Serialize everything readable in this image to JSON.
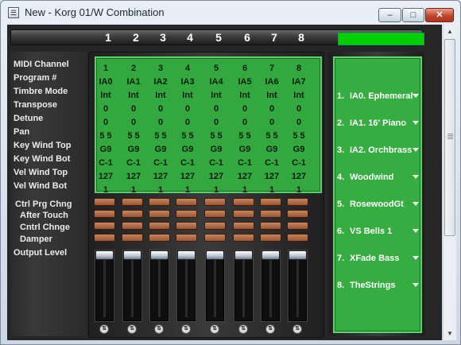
{
  "window": {
    "title": "New - Korg 01/W Combination",
    "app_icon_glyph": "☰",
    "minimize_glyph": "–",
    "maximize_glyph": "□",
    "close_glyph": "✕"
  },
  "channels": [
    "1",
    "2",
    "3",
    "4",
    "5",
    "6",
    "7",
    "8"
  ],
  "level_meter": {
    "color": "#00d000"
  },
  "param_labels": [
    "MIDI Channel",
    "Program #",
    "Timbre Mode",
    "Transpose",
    "Detune",
    "Pan",
    "Key Wind Top",
    "Key Wind Bot",
    "Vel Wind Top",
    "Vel Wind Bot"
  ],
  "toggle_labels": [
    "Ctrl Prg Chng",
    "After Touch",
    "Cntrl Chnge",
    "Damper"
  ],
  "output_label": "Output Level",
  "grid": [
    [
      "1",
      "2",
      "3",
      "4",
      "5",
      "6",
      "7",
      "8"
    ],
    [
      "IA0",
      "IA1",
      "IA2",
      "IA3",
      "IA4",
      "IA5",
      "IA6",
      "IA7"
    ],
    [
      "Int",
      "Int",
      "Int",
      "Int",
      "Int",
      "Int",
      "Int",
      "Int"
    ],
    [
      "0",
      "0",
      "0",
      "0",
      "0",
      "0",
      "0",
      "0"
    ],
    [
      "0",
      "0",
      "0",
      "0",
      "0",
      "0",
      "0",
      "0"
    ],
    [
      "5 5",
      "5 5",
      "5 5",
      "5 5",
      "5 5",
      "5 5",
      "5 5",
      "5 5"
    ],
    [
      "G9",
      "G9",
      "G9",
      "G9",
      "G9",
      "G9",
      "G9",
      "G9"
    ],
    [
      "C-1",
      "C-1",
      "C-1",
      "C-1",
      "C-1",
      "C-1",
      "C-1",
      "C-1"
    ],
    [
      "127",
      "127",
      "127",
      "127",
      "127",
      "127",
      "127",
      "127"
    ],
    [
      "1",
      "1",
      "1",
      "1",
      "1",
      "1",
      "1",
      "1"
    ]
  ],
  "faders": {
    "levels": [
      1,
      1,
      1,
      1,
      1,
      1,
      1,
      1
    ],
    "knob_glyph": "⇅"
  },
  "programs": [
    {
      "num": "1.",
      "name": "IA0. Ephemeral"
    },
    {
      "num": "2.",
      "name": "IA1. 16' Piano"
    },
    {
      "num": "3.",
      "name": "IA2. Orchbrass"
    },
    {
      "num": "4.",
      "name": "Woodwind"
    },
    {
      "num": "5.",
      "name": "RosewoodGt"
    },
    {
      "num": "6.",
      "name": "VS Bells 1"
    },
    {
      "num": "7.",
      "name": "XFade Bass"
    },
    {
      "num": "8.",
      "name": "TheStrings"
    }
  ],
  "scrollbar": {
    "up_glyph": "▲",
    "down_glyph": "▼"
  }
}
